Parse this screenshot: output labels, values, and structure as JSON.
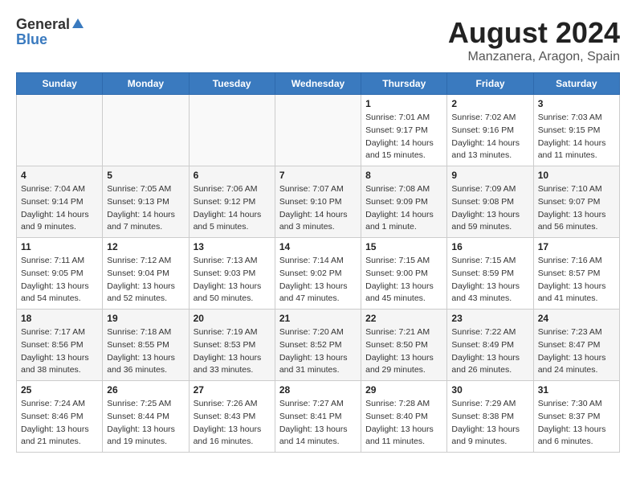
{
  "header": {
    "logo_general": "General",
    "logo_blue": "Blue",
    "month_year": "August 2024",
    "location": "Manzanera, Aragon, Spain"
  },
  "days_of_week": [
    "Sunday",
    "Monday",
    "Tuesday",
    "Wednesday",
    "Thursday",
    "Friday",
    "Saturday"
  ],
  "weeks": [
    {
      "row_class": "row-white",
      "days": [
        {
          "num": "",
          "info": "",
          "empty": true
        },
        {
          "num": "",
          "info": "",
          "empty": true
        },
        {
          "num": "",
          "info": "",
          "empty": true
        },
        {
          "num": "",
          "info": "",
          "empty": true
        },
        {
          "num": "1",
          "info": "Sunrise: 7:01 AM\nSunset: 9:17 PM\nDaylight: 14 hours\nand 15 minutes.",
          "empty": false
        },
        {
          "num": "2",
          "info": "Sunrise: 7:02 AM\nSunset: 9:16 PM\nDaylight: 14 hours\nand 13 minutes.",
          "empty": false
        },
        {
          "num": "3",
          "info": "Sunrise: 7:03 AM\nSunset: 9:15 PM\nDaylight: 14 hours\nand 11 minutes.",
          "empty": false
        }
      ]
    },
    {
      "row_class": "row-gray",
      "days": [
        {
          "num": "4",
          "info": "Sunrise: 7:04 AM\nSunset: 9:14 PM\nDaylight: 14 hours\nand 9 minutes.",
          "empty": false
        },
        {
          "num": "5",
          "info": "Sunrise: 7:05 AM\nSunset: 9:13 PM\nDaylight: 14 hours\nand 7 minutes.",
          "empty": false
        },
        {
          "num": "6",
          "info": "Sunrise: 7:06 AM\nSunset: 9:12 PM\nDaylight: 14 hours\nand 5 minutes.",
          "empty": false
        },
        {
          "num": "7",
          "info": "Sunrise: 7:07 AM\nSunset: 9:10 PM\nDaylight: 14 hours\nand 3 minutes.",
          "empty": false
        },
        {
          "num": "8",
          "info": "Sunrise: 7:08 AM\nSunset: 9:09 PM\nDaylight: 14 hours\nand 1 minute.",
          "empty": false
        },
        {
          "num": "9",
          "info": "Sunrise: 7:09 AM\nSunset: 9:08 PM\nDaylight: 13 hours\nand 59 minutes.",
          "empty": false
        },
        {
          "num": "10",
          "info": "Sunrise: 7:10 AM\nSunset: 9:07 PM\nDaylight: 13 hours\nand 56 minutes.",
          "empty": false
        }
      ]
    },
    {
      "row_class": "row-white",
      "days": [
        {
          "num": "11",
          "info": "Sunrise: 7:11 AM\nSunset: 9:05 PM\nDaylight: 13 hours\nand 54 minutes.",
          "empty": false
        },
        {
          "num": "12",
          "info": "Sunrise: 7:12 AM\nSunset: 9:04 PM\nDaylight: 13 hours\nand 52 minutes.",
          "empty": false
        },
        {
          "num": "13",
          "info": "Sunrise: 7:13 AM\nSunset: 9:03 PM\nDaylight: 13 hours\nand 50 minutes.",
          "empty": false
        },
        {
          "num": "14",
          "info": "Sunrise: 7:14 AM\nSunset: 9:02 PM\nDaylight: 13 hours\nand 47 minutes.",
          "empty": false
        },
        {
          "num": "15",
          "info": "Sunrise: 7:15 AM\nSunset: 9:00 PM\nDaylight: 13 hours\nand 45 minutes.",
          "empty": false
        },
        {
          "num": "16",
          "info": "Sunrise: 7:15 AM\nSunset: 8:59 PM\nDaylight: 13 hours\nand 43 minutes.",
          "empty": false
        },
        {
          "num": "17",
          "info": "Sunrise: 7:16 AM\nSunset: 8:57 PM\nDaylight: 13 hours\nand 41 minutes.",
          "empty": false
        }
      ]
    },
    {
      "row_class": "row-gray",
      "days": [
        {
          "num": "18",
          "info": "Sunrise: 7:17 AM\nSunset: 8:56 PM\nDaylight: 13 hours\nand 38 minutes.",
          "empty": false
        },
        {
          "num": "19",
          "info": "Sunrise: 7:18 AM\nSunset: 8:55 PM\nDaylight: 13 hours\nand 36 minutes.",
          "empty": false
        },
        {
          "num": "20",
          "info": "Sunrise: 7:19 AM\nSunset: 8:53 PM\nDaylight: 13 hours\nand 33 minutes.",
          "empty": false
        },
        {
          "num": "21",
          "info": "Sunrise: 7:20 AM\nSunset: 8:52 PM\nDaylight: 13 hours\nand 31 minutes.",
          "empty": false
        },
        {
          "num": "22",
          "info": "Sunrise: 7:21 AM\nSunset: 8:50 PM\nDaylight: 13 hours\nand 29 minutes.",
          "empty": false
        },
        {
          "num": "23",
          "info": "Sunrise: 7:22 AM\nSunset: 8:49 PM\nDaylight: 13 hours\nand 26 minutes.",
          "empty": false
        },
        {
          "num": "24",
          "info": "Sunrise: 7:23 AM\nSunset: 8:47 PM\nDaylight: 13 hours\nand 24 minutes.",
          "empty": false
        }
      ]
    },
    {
      "row_class": "row-white",
      "days": [
        {
          "num": "25",
          "info": "Sunrise: 7:24 AM\nSunset: 8:46 PM\nDaylight: 13 hours\nand 21 minutes.",
          "empty": false
        },
        {
          "num": "26",
          "info": "Sunrise: 7:25 AM\nSunset: 8:44 PM\nDaylight: 13 hours\nand 19 minutes.",
          "empty": false
        },
        {
          "num": "27",
          "info": "Sunrise: 7:26 AM\nSunset: 8:43 PM\nDaylight: 13 hours\nand 16 minutes.",
          "empty": false
        },
        {
          "num": "28",
          "info": "Sunrise: 7:27 AM\nSunset: 8:41 PM\nDaylight: 13 hours\nand 14 minutes.",
          "empty": false
        },
        {
          "num": "29",
          "info": "Sunrise: 7:28 AM\nSunset: 8:40 PM\nDaylight: 13 hours\nand 11 minutes.",
          "empty": false
        },
        {
          "num": "30",
          "info": "Sunrise: 7:29 AM\nSunset: 8:38 PM\nDaylight: 13 hours\nand 9 minutes.",
          "empty": false
        },
        {
          "num": "31",
          "info": "Sunrise: 7:30 AM\nSunset: 8:37 PM\nDaylight: 13 hours\nand 6 minutes.",
          "empty": false
        }
      ]
    }
  ]
}
